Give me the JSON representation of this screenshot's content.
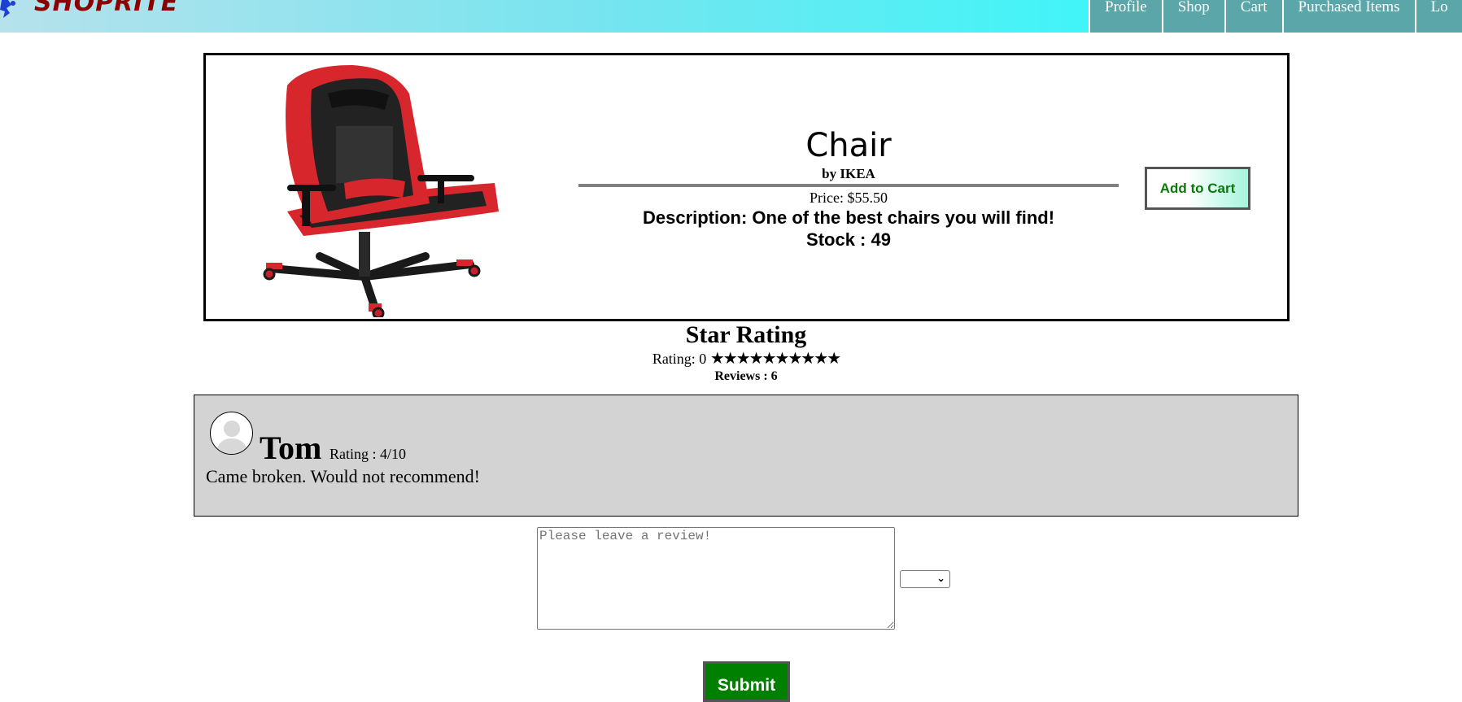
{
  "header": {
    "logo_text": "SHOPRITE",
    "nav": [
      "Profile",
      "Shop",
      "Cart",
      "Purchased Items",
      "Lo"
    ]
  },
  "product": {
    "name": "Chair",
    "brand": "by IKEA",
    "price": "Price: $55.50",
    "description": "Description: One of the best chairs you will find!",
    "stock": "Stock : 49",
    "add_to_cart_label": "Add to Cart"
  },
  "rating": {
    "title": "Star Rating",
    "label": "Rating: 0",
    "stars": 10,
    "reviews": "Reviews : 6"
  },
  "reviews": [
    {
      "name": "Tom",
      "rating": "Rating : 4/10",
      "text": "Came broken. Would not recommend!"
    }
  ],
  "review_form": {
    "placeholder": "Please leave a review!",
    "select_value": "",
    "submit_label": "Submit"
  },
  "colors": {
    "brand": "#8b0000",
    "nav_bg": "#5aa6a8",
    "submit_bg": "#008000",
    "add_to_cart_text": "#0a7a0a"
  }
}
